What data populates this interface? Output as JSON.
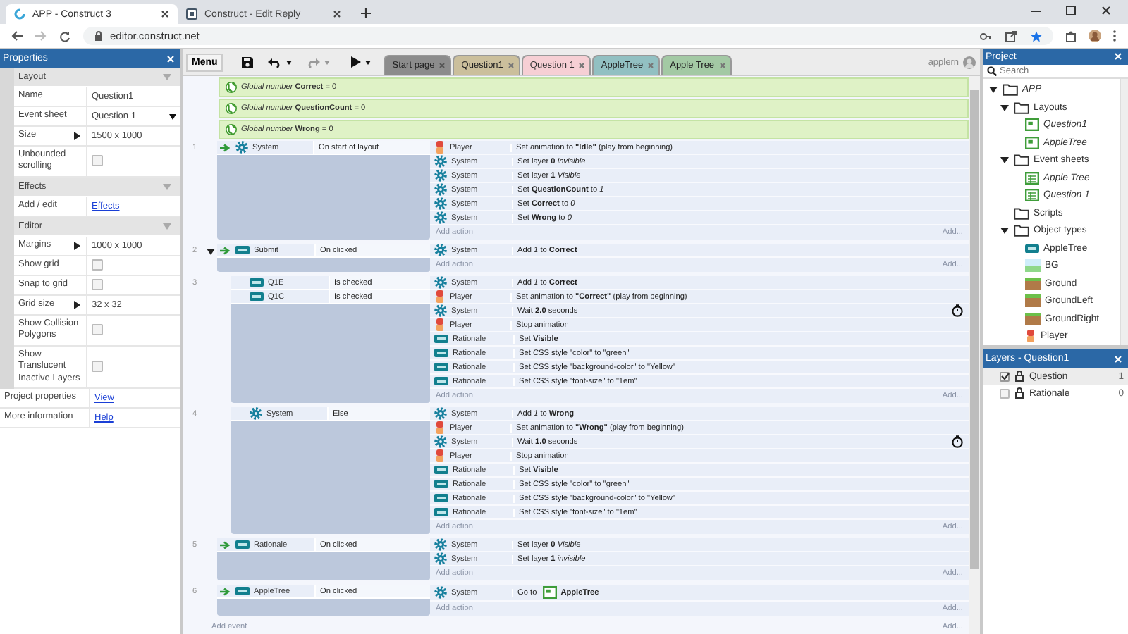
{
  "browser": {
    "tabs": [
      {
        "title": "APP - Construct 3",
        "selected": true
      },
      {
        "title": "Construct - Edit Reply",
        "selected": false
      }
    ],
    "url": "editor.construct.net"
  },
  "properties": {
    "title": "Properties",
    "sections": [
      {
        "title": "Layout",
        "rows": [
          {
            "label": "Name",
            "kind": "text",
            "value": "Question1"
          },
          {
            "label": "Event sheet",
            "kind": "dropdown",
            "value": "Question 1"
          },
          {
            "label": "Size",
            "kind": "expand",
            "value": "1500 x 1000"
          },
          {
            "label": "Unbounded scrolling",
            "kind": "checkbox",
            "checked": false
          }
        ]
      },
      {
        "title": "Effects",
        "rows": [
          {
            "label": "Add / edit",
            "kind": "link",
            "value": "Effects"
          }
        ]
      },
      {
        "title": "Editor",
        "rows": [
          {
            "label": "Margins",
            "kind": "expand",
            "value": "1000 x 1000"
          },
          {
            "label": "Show grid",
            "kind": "checkbox",
            "checked": false
          },
          {
            "label": "Snap to grid",
            "kind": "checkbox",
            "checked": false
          },
          {
            "label": "Grid size",
            "kind": "expand",
            "value": "32 x 32"
          },
          {
            "label": "Show Collision Polygons",
            "kind": "checkbox",
            "checked": false
          },
          {
            "label": "Show Translucent Inactive Layers",
            "kind": "checkbox",
            "checked": false
          }
        ]
      }
    ],
    "footer": [
      {
        "label": "Project properties",
        "link": "View"
      },
      {
        "label": "More information",
        "link": "Help"
      }
    ]
  },
  "toolbar": {
    "menu": "Menu",
    "tabs": [
      {
        "label": "Start page",
        "color": "#8c8c8c",
        "selected": false
      },
      {
        "label": "Question1",
        "color": "#cbbf9c",
        "selected": false
      },
      {
        "label": "Question 1",
        "color": "#f6cfd4",
        "selected": true
      },
      {
        "label": "AppleTree",
        "color": "#92c0c2",
        "selected": false
      },
      {
        "label": "Apple Tree",
        "color": "#a3c9a4",
        "selected": false
      }
    ],
    "user": "applern"
  },
  "globals": [
    "*Global number* **Correct** = 0",
    "*Global number* **QuestionCount** = 0",
    "*Global number* **Wrong** = 0"
  ],
  "events": [
    {
      "number": "1",
      "trigger": true,
      "conditions": [
        {
          "object": "System",
          "kind": "gear",
          "text": "On start of layout"
        }
      ],
      "actions": [
        {
          "object": "Player",
          "kind": "sprite",
          "text": "Set animation to **\"Idle\"** (play from beginning)",
          "wait": false
        },
        {
          "object": "System",
          "kind": "gear",
          "text": "Set layer **0** *invisible*",
          "wait": false
        },
        {
          "object": "System",
          "kind": "gear",
          "text": "Set layer **1** *Visible*",
          "wait": false
        },
        {
          "object": "System",
          "kind": "gear",
          "text": "Set **QuestionCount** to *1*",
          "wait": false
        },
        {
          "object": "System",
          "kind": "gear",
          "text": "Set **Correct** to *0*",
          "wait": false
        },
        {
          "object": "System",
          "kind": "gear",
          "text": "Set **Wrong** to *0*",
          "wait": false
        }
      ],
      "add_action": "Add action",
      "add": "Add..."
    },
    {
      "number": "2",
      "trigger": true,
      "expanded": true,
      "conditions": [
        {
          "object": "Submit",
          "kind": "button",
          "text": "On clicked"
        }
      ],
      "actions": [
        {
          "object": "System",
          "kind": "gear",
          "text": "Add *1* to **Correct**",
          "wait": false
        }
      ],
      "add_action": "Add action",
      "add": "Add...",
      "children": [
        {
          "number": "3",
          "trigger": false,
          "conditions": [
            {
              "object": "Q1E",
              "kind": "button",
              "text": "Is checked"
            },
            {
              "object": "Q1C",
              "kind": "button",
              "text": "Is checked"
            }
          ],
          "actions": [
            {
              "object": "System",
              "kind": "gear",
              "text": "Add *1* to **Correct**",
              "wait": false
            },
            {
              "object": "Player",
              "kind": "sprite",
              "text": "Set animation to **\"Correct\"** (play from beginning)",
              "wait": false
            },
            {
              "object": "System",
              "kind": "gear",
              "text": "Wait **2.0** seconds",
              "wait": true
            },
            {
              "object": "Player",
              "kind": "sprite",
              "text": "Stop animation",
              "wait": false
            },
            {
              "object": "Rationale",
              "kind": "button",
              "text": "Set **Visible**",
              "wait": false
            },
            {
              "object": "Rationale",
              "kind": "button",
              "text": "Set CSS style \"color\" to \"green\"",
              "wait": false
            },
            {
              "object": "Rationale",
              "kind": "button",
              "text": "Set CSS style \"background-color\" to \"Yellow\"",
              "wait": false
            },
            {
              "object": "Rationale",
              "kind": "button",
              "text": "Set CSS style \"font-size\" to \"1em\"",
              "wait": false
            }
          ],
          "add_action": "Add action",
          "add": "Add..."
        },
        {
          "number": "4",
          "trigger": false,
          "conditions": [
            {
              "object": "System",
              "kind": "gear",
              "text": "Else"
            }
          ],
          "actions": [
            {
              "object": "System",
              "kind": "gear",
              "text": "Add *1* to **Wrong**",
              "wait": false
            },
            {
              "object": "Player",
              "kind": "sprite",
              "text": "Set animation to **\"Wrong\"** (play from beginning)",
              "wait": false
            },
            {
              "object": "System",
              "kind": "gear",
              "text": "Wait **1.0** seconds",
              "wait": true
            },
            {
              "object": "Player",
              "kind": "sprite",
              "text": "Stop animation",
              "wait": false
            },
            {
              "object": "Rationale",
              "kind": "button",
              "text": "Set **Visible**",
              "wait": false
            },
            {
              "object": "Rationale",
              "kind": "button",
              "text": "Set CSS style \"color\" to \"green\"",
              "wait": false
            },
            {
              "object": "Rationale",
              "kind": "button",
              "text": "Set CSS style \"background-color\" to \"Yellow\"",
              "wait": false
            },
            {
              "object": "Rationale",
              "kind": "button",
              "text": "Set CSS style \"font-size\" to \"1em\"",
              "wait": false
            }
          ],
          "add_action": "Add action",
          "add": "Add..."
        }
      ]
    },
    {
      "number": "5",
      "trigger": true,
      "conditions": [
        {
          "object": "Rationale",
          "kind": "button",
          "text": "On clicked"
        }
      ],
      "actions": [
        {
          "object": "System",
          "kind": "gear",
          "text": "Set layer **0** *Visible*",
          "wait": false
        },
        {
          "object": "System",
          "kind": "gear",
          "text": "Set layer **1** *invisible*",
          "wait": false
        }
      ],
      "add_action": "Add action",
      "add": "Add..."
    },
    {
      "number": "6",
      "trigger": true,
      "conditions": [
        {
          "object": "AppleTree",
          "kind": "button",
          "text": "On clicked"
        }
      ],
      "actions": [
        {
          "object": "System",
          "kind": "gear",
          "text": "Go to",
          "target": "AppleTree",
          "wait": false
        }
      ],
      "add_action": "Add action",
      "add": "Add..."
    }
  ],
  "add_event": "Add event",
  "add_bottom": "Add...",
  "project": {
    "title": "Project",
    "search_placeholder": "Search",
    "tree": [
      {
        "label": "APP",
        "kind": "folder",
        "italic": true,
        "expanded": true,
        "children": [
          {
            "label": "Layouts",
            "kind": "folder",
            "italic": false,
            "expanded": true,
            "children": [
              {
                "label": "Question1",
                "kind": "layout",
                "italic": true
              },
              {
                "label": "AppleTree",
                "kind": "layout",
                "italic": true
              }
            ]
          },
          {
            "label": "Event sheets",
            "kind": "folder",
            "italic": false,
            "expanded": true,
            "children": [
              {
                "label": "Apple Tree",
                "kind": "sheet",
                "italic": true
              },
              {
                "label": "Question 1",
                "kind": "sheet",
                "italic": true
              }
            ]
          },
          {
            "label": "Scripts",
            "kind": "folder",
            "italic": false
          },
          {
            "label": "Object types",
            "kind": "folder",
            "italic": false,
            "expanded": true,
            "children": [
              {
                "label": "AppleTree",
                "kind": "button",
                "italic": false
              },
              {
                "label": "BG",
                "kind": "bg",
                "italic": false
              },
              {
                "label": "Ground",
                "kind": "ground",
                "italic": false
              },
              {
                "label": "GroundLeft",
                "kind": "ground",
                "italic": false
              },
              {
                "label": "GroundRight",
                "kind": "ground",
                "italic": false
              },
              {
                "label": "Player",
                "kind": "sprite",
                "italic": false
              }
            ]
          }
        ]
      }
    ]
  },
  "layers": {
    "title": "Layers - Question1",
    "items": [
      {
        "name": "Question",
        "checked": true,
        "count": "1"
      },
      {
        "name": "Rationale",
        "checked": false,
        "count": "0"
      }
    ]
  }
}
